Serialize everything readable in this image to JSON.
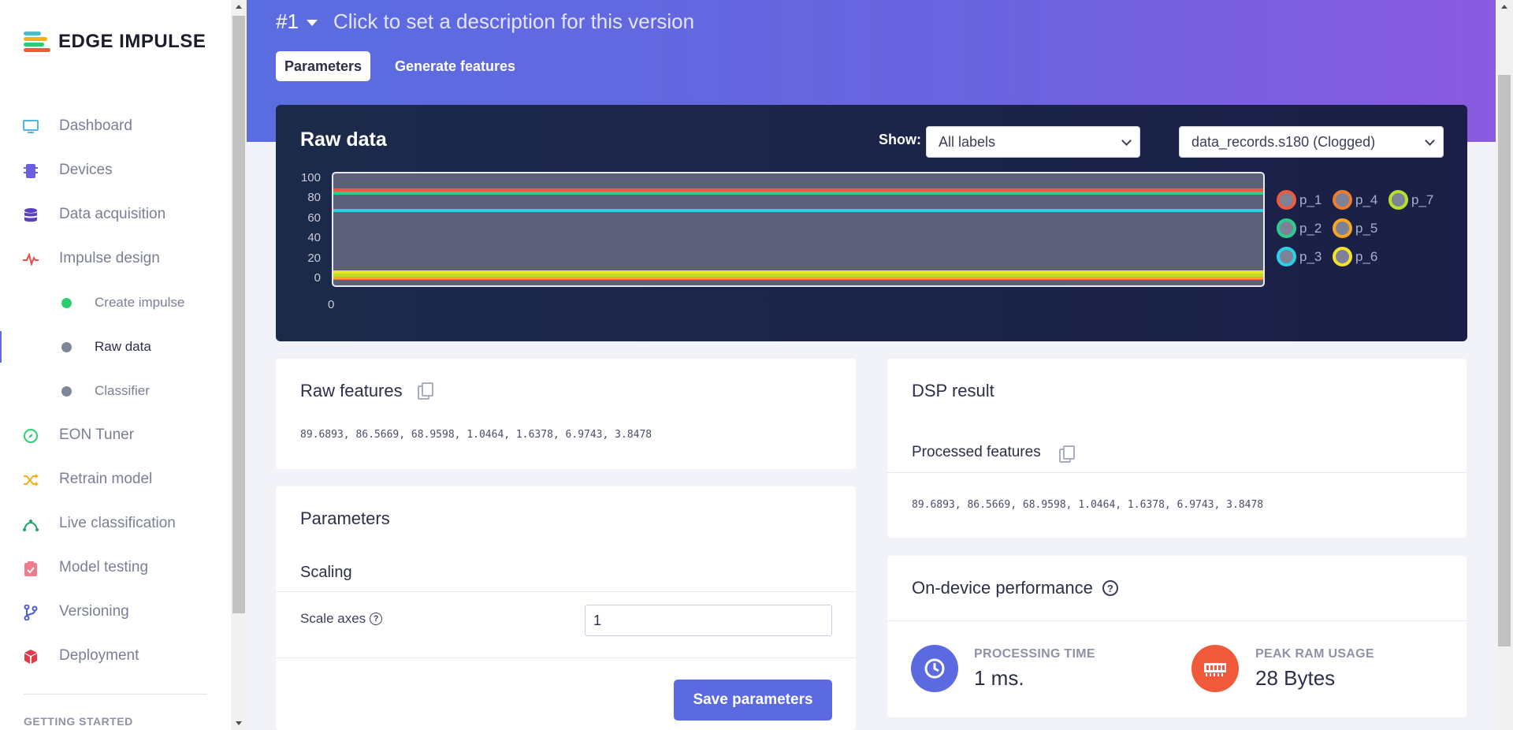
{
  "brand": {
    "name": "EDGE IMPULSE"
  },
  "sidebar": {
    "items": [
      {
        "label": "Dashboard",
        "icon": "monitor-icon",
        "color": "#4fb8d8"
      },
      {
        "label": "Devices",
        "icon": "chip-icon",
        "color": "#6b5fe0"
      },
      {
        "label": "Data acquisition",
        "icon": "database-icon",
        "color": "#5b3fc0"
      },
      {
        "label": "Impulse design",
        "icon": "pulse-icon",
        "color": "#e84b4b"
      }
    ],
    "sub_items": [
      {
        "label": "Create impulse",
        "dot": "#2ecc71"
      },
      {
        "label": "Raw data",
        "dot": "#7e8699"
      },
      {
        "label": "Classifier",
        "dot": "#7e8699"
      }
    ],
    "items_after": [
      {
        "label": "EON Tuner",
        "icon": "compass-icon",
        "color": "#2ecc71"
      },
      {
        "label": "Retrain model",
        "icon": "shuffle-icon",
        "color": "#f2b01e"
      },
      {
        "label": "Live classification",
        "icon": "curve-icon",
        "color": "#22a36a"
      },
      {
        "label": "Model testing",
        "icon": "clipboard-check-icon",
        "color": "#f07b8e"
      },
      {
        "label": "Versioning",
        "icon": "git-branch-icon",
        "color": "#4a5fd6"
      },
      {
        "label": "Deployment",
        "icon": "cube-icon",
        "color": "#e23a4a"
      }
    ],
    "section": "GETTING STARTED"
  },
  "header": {
    "version": "#1",
    "description": "Click to set a description for this version",
    "tabs": [
      "Parameters",
      "Generate features"
    ]
  },
  "raw_data": {
    "title": "Raw data",
    "show_label": "Show:",
    "label_filter": "All labels",
    "sample": "data_records.s180 (Clogged)",
    "y_ticks": [
      "100",
      "80",
      "60",
      "40",
      "20",
      "0"
    ],
    "x_ticks": [
      "0"
    ],
    "legend": [
      {
        "name": "p_1",
        "color": "#ef5a3a"
      },
      {
        "name": "p_2",
        "color": "#2ecc8a"
      },
      {
        "name": "p_3",
        "color": "#28d3e8"
      },
      {
        "name": "p_4",
        "color": "#f07c2a"
      },
      {
        "name": "p_5",
        "color": "#f5a623"
      },
      {
        "name": "p_6",
        "color": "#f2e22a"
      },
      {
        "name": "p_7",
        "color": "#b7e02a"
      }
    ]
  },
  "chart_data": {
    "type": "line",
    "title": "Raw data",
    "ylim": [
      0,
      100
    ],
    "x": [
      0
    ],
    "series": [
      {
        "name": "p_1",
        "values": [
          89.6893
        ]
      },
      {
        "name": "p_2",
        "values": [
          86.5669
        ]
      },
      {
        "name": "p_3",
        "values": [
          68.9598
        ]
      },
      {
        "name": "p_4",
        "values": [
          1.0464
        ]
      },
      {
        "name": "p_5",
        "values": [
          1.6378
        ]
      },
      {
        "name": "p_6",
        "values": [
          6.9743
        ]
      },
      {
        "name": "p_7",
        "values": [
          3.8478
        ]
      }
    ]
  },
  "raw_features": {
    "title": "Raw features",
    "values": "89.6893, 86.5669, 68.9598, 1.0464, 1.6378, 6.9743, 3.8478"
  },
  "parameters": {
    "title": "Parameters",
    "section": "Scaling",
    "scale_label": "Scale axes",
    "scale_value": "1",
    "save_label": "Save parameters"
  },
  "dsp": {
    "title": "DSP result",
    "processed_title": "Processed features",
    "values": "89.6893, 86.5669, 68.9598, 1.0464, 1.6378, 6.9743, 3.8478"
  },
  "performance": {
    "title": "On-device performance",
    "processing_label": "PROCESSING TIME",
    "processing_value": "1 ms.",
    "ram_label": "PEAK RAM USAGE",
    "ram_value": "28 Bytes",
    "processing_color": "#5b6ae0",
    "ram_color": "#f05a3a"
  }
}
